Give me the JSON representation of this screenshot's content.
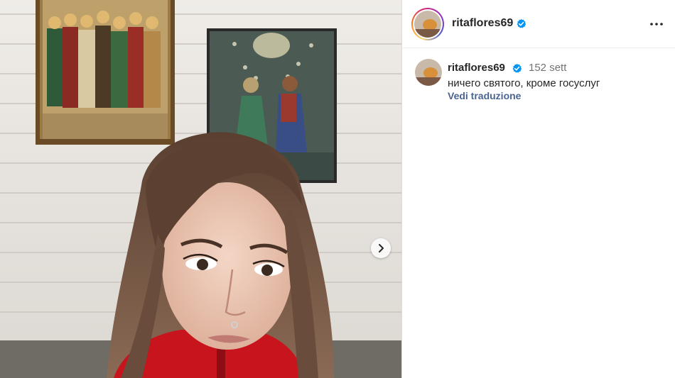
{
  "post": {
    "username": "ritaflores69",
    "verified": true,
    "caption": {
      "username": "ritaflores69",
      "time_ago": "152 sett",
      "text": "ничего святого, кроме госуслуг",
      "translate_label": "Vedi traduzione"
    }
  },
  "icons": {
    "verified": "verified-badge-icon",
    "more": "more-options-icon",
    "next": "chevron-right-icon"
  },
  "colors": {
    "verified_blue": "#0095f6",
    "text_primary": "#262626",
    "text_secondary": "#737373",
    "link": "#4a6590"
  }
}
